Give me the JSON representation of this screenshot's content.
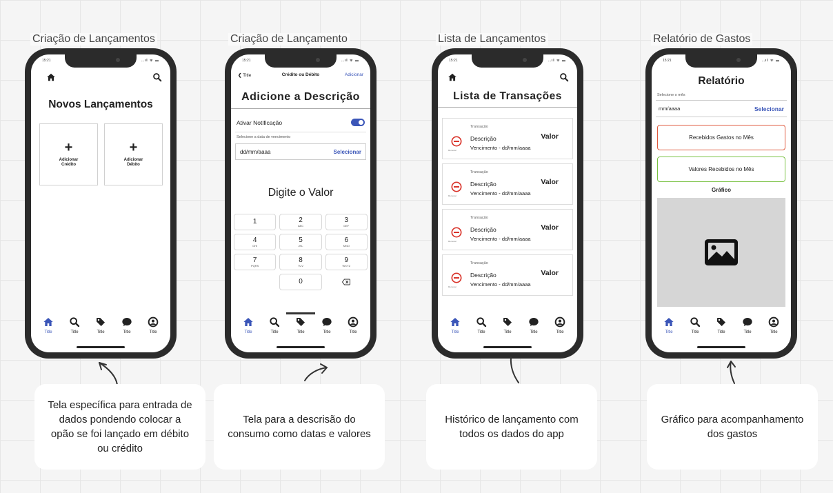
{
  "canvas": {
    "titles": [
      "Criação de Lançamentos",
      "Criação de Lançamento",
      "Lista de Lançamentos",
      "Relatório de Gastos"
    ],
    "notes": [
      "Tela específica para entrada de dados pondendo colocar a opão se foi lançado em débito ou crédito",
      "Tela para a descrisão do consumo como datas e valores",
      "Histórico de lançamento com todos os dados do app",
      "Gráfico para acompanhamento dos gastos"
    ]
  },
  "status_bar": {
    "time": "15:21",
    "icons": "..ıl ᯤ ▬"
  },
  "tab_bar": {
    "items": [
      {
        "label": "Title",
        "icon": "home-icon"
      },
      {
        "label": "Title",
        "icon": "search-icon"
      },
      {
        "label": "Title",
        "icon": "tag-icon"
      },
      {
        "label": "Title",
        "icon": "chat-icon"
      },
      {
        "label": "Title",
        "icon": "user-icon"
      }
    ],
    "active_color": "#3b56b8"
  },
  "screen1": {
    "title": "Novos Lançamentos",
    "add_credit": "Adicionar\nCrédito",
    "add_debit": "Adicionar\nDébito",
    "plus": "+"
  },
  "screen2": {
    "back_label": "Title",
    "nav_title": "Crédito ou Débito",
    "nav_action": "Adicionar",
    "title": "Adicione a Descrição",
    "toggle_label": "Ativar Notificação",
    "date_hint": "Selecione a data de vencimento",
    "date_value": "dd/mm/aaaa",
    "select_label": "Selecionar",
    "digit_prompt": "Digite o Valor",
    "keys": [
      {
        "num": "1",
        "letters": ""
      },
      {
        "num": "2",
        "letters": "ABC"
      },
      {
        "num": "3",
        "letters": "DEF"
      },
      {
        "num": "4",
        "letters": "GHI"
      },
      {
        "num": "5",
        "letters": "JKL"
      },
      {
        "num": "6",
        "letters": "MNO"
      },
      {
        "num": "7",
        "letters": "PQRS"
      },
      {
        "num": "8",
        "letters": "TUV"
      },
      {
        "num": "9",
        "letters": "WXYZ"
      },
      {
        "num": "0",
        "letters": ""
      }
    ]
  },
  "screen3": {
    "title": "Lista de Transações",
    "transactions": [
      {
        "label": "Transação",
        "description": "Descrição",
        "value": "Valor",
        "due": "Vencimento - dd/mm/aaaa",
        "icon_label": "Remover"
      },
      {
        "label": "Transação",
        "description": "Descrição",
        "value": "Valor",
        "due": "Vencimento - dd/mm/aaaa",
        "icon_label": "Remover"
      },
      {
        "label": "Transação",
        "description": "Descrição",
        "value": "Valor",
        "due": "Vencimento - dd/mm/aaaa",
        "icon_label": "Remover"
      },
      {
        "label": "Transação",
        "description": "Descrição",
        "value": "Valor",
        "due": "Vencimento - dd/mm/aaaa",
        "icon_label": "Remover"
      }
    ]
  },
  "screen4": {
    "title": "Relatório",
    "month_hint": "Selecione o mês",
    "month_value": "mm/aaaa",
    "select_label": "Selecionar",
    "spent_button": "Recebidos Gastos no Mês",
    "received_button": "Valores Recebidos no Mês",
    "chart_title": "Gráfico"
  },
  "colors": {
    "accent": "#3b56b8",
    "red": "#e05a3e",
    "green": "#7ac243"
  }
}
